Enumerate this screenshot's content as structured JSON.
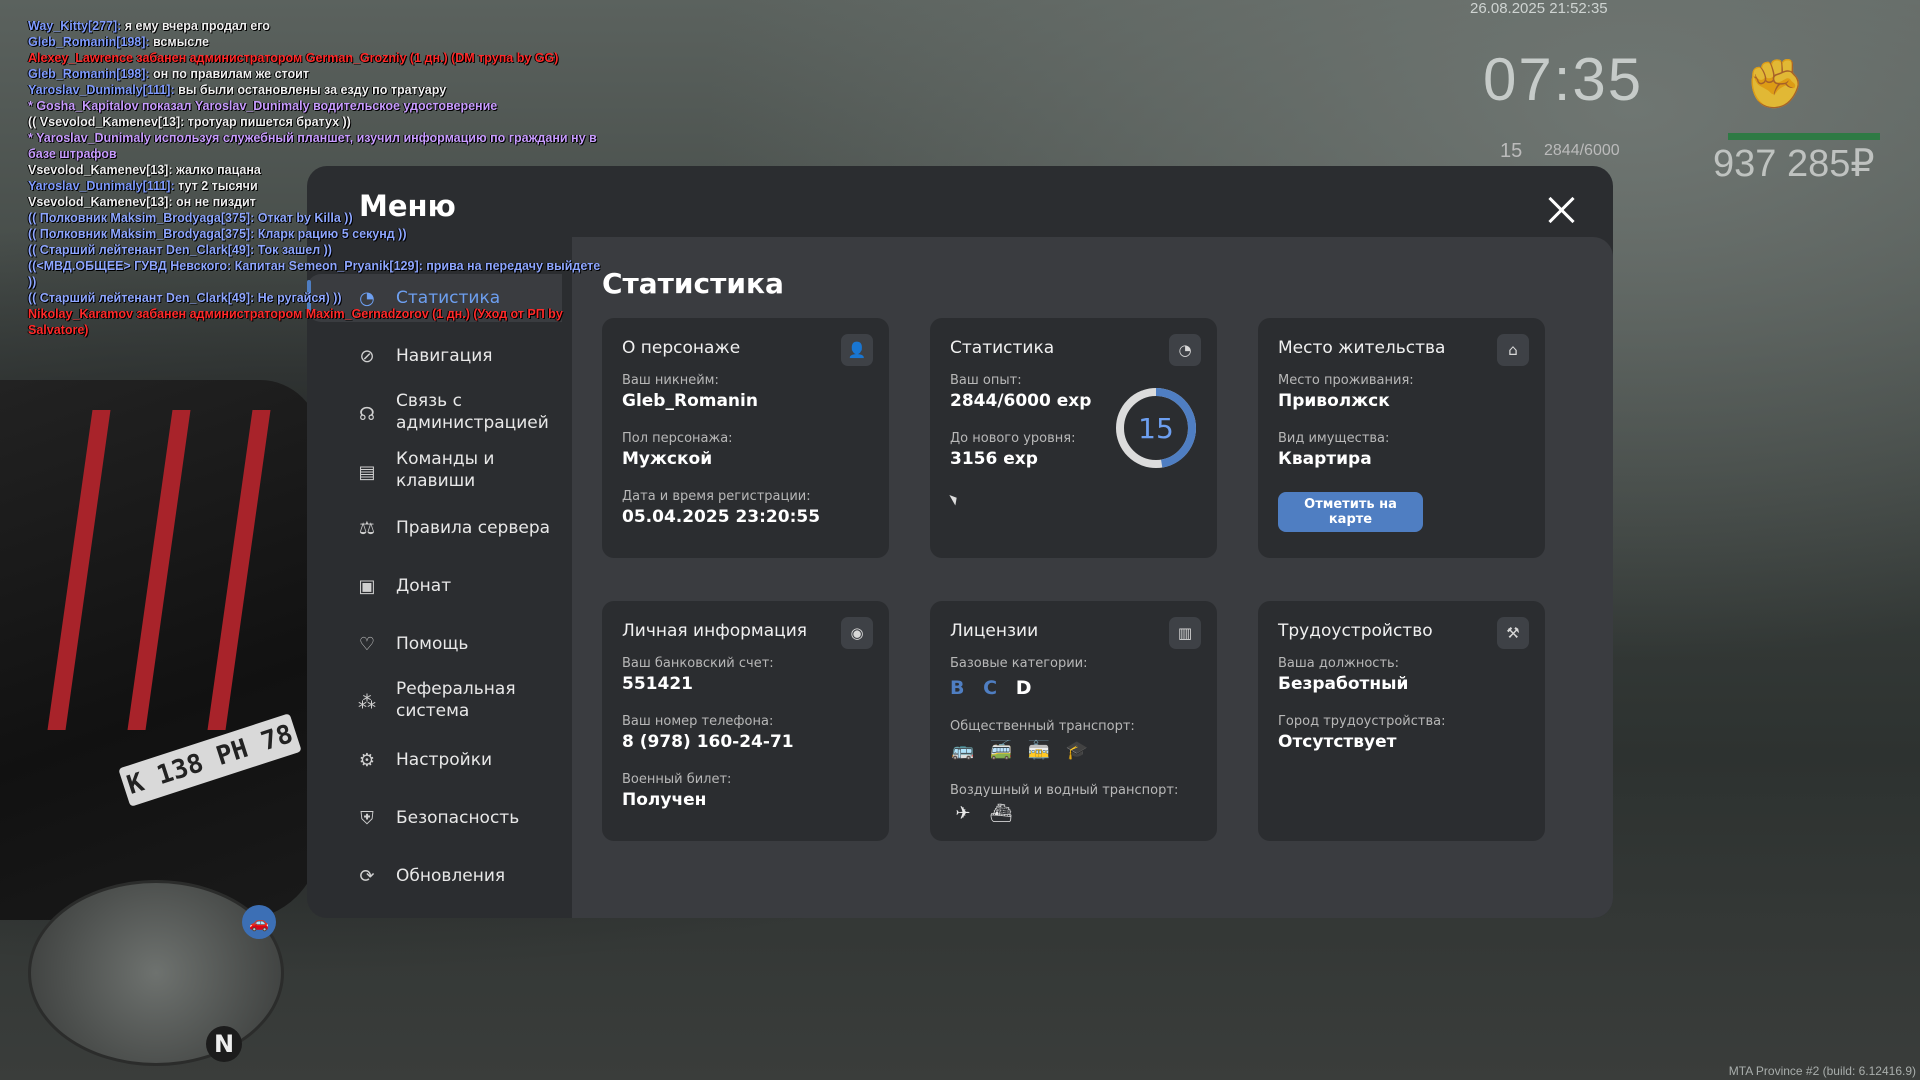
{
  "background": {
    "datetime": "26.08.2025 21:52:35",
    "time": "07:35",
    "level": "15",
    "exp": "2844/6000",
    "money": "937 285₽",
    "plate": "К 138 РН 78",
    "minimap_north": "N",
    "build": "MTA Province #2 (build: 6.12416.9)"
  },
  "chat": [
    {
      "name": "Way_Kitty[277]:",
      "text": " я ему вчера продал его",
      "color": "blue"
    },
    {
      "name": "Gleb_Romanin[198]:",
      "text": " всмысле",
      "color": "blue"
    },
    {
      "name": "",
      "text": "Alexey_Lawrence забанен администратором German_Grozniy (1 дн.) (DM трупа by GG)",
      "color": "red"
    },
    {
      "name": "Gleb_Romanin[198]:",
      "text": " он по правилам же стоит",
      "color": "blue"
    },
    {
      "name": "Yaroslav_Dunimaly[111]:",
      "text": " вы были остановлены за езду по тратуару",
      "color": "blue"
    },
    {
      "name": "",
      "text": "* Gosha_Kapitalov показал Yaroslav_Dunimaly водительское удостоверение",
      "color": "purple"
    },
    {
      "name": "",
      "text": "(( Vsevolod_Kamenev[13]: тротуар пишется братух ))",
      "color": "white"
    },
    {
      "name": "",
      "text": "* Yaroslav_Dunimaly используя служебный планшет, изучил информацию по граждани ну в базе штрафов",
      "color": "purple"
    },
    {
      "name": "",
      "text": "Vsevolod_Kamenev[13]: жалко пацана",
      "color": "white"
    },
    {
      "name": "Yaroslav_Dunimaly[111]:",
      "text": " тут 2 тысячи",
      "color": "blue"
    },
    {
      "name": "",
      "text": "Vsevolod_Kamenev[13]: он не пиздит",
      "color": "white"
    },
    {
      "name": "",
      "text": "(( Полковник Maksim_Brodyaga[375]: Откат by Killa ))",
      "color": "lblue"
    },
    {
      "name": "",
      "text": "(( Полковник Maksim_Brodyaga[375]: Кларк рацию 5 секунд ))",
      "color": "lblue"
    },
    {
      "name": "",
      "text": "(( Старший лейтенант Den_Clark[49]: Ток зашел ))",
      "color": "lblue"
    },
    {
      "name": "",
      "text": "((<МВД.ОБЩЕЕ> ГУВД Невского: Капитан Semeon_Pryanik[129]: прива на передачу выйдете ))",
      "color": "lblue"
    },
    {
      "name": "",
      "text": "(( Старший лейтенант Den_Clark[49]: Не ругайся) ))",
      "color": "lblue"
    },
    {
      "name": "",
      "text": "Nikolay_Karamov забанен администратором Maxim_Gernadzorov (1 дн.) (Уход от РП by Salvatore)",
      "color": "red"
    }
  ],
  "menu": {
    "title": "Меню",
    "nav": [
      {
        "label": "Статистика",
        "icon": "pie-chart-icon",
        "glyph": "◔"
      },
      {
        "label": "Навигация",
        "icon": "compass-icon",
        "glyph": "⊘"
      },
      {
        "label": "Связь с администрацией",
        "icon": "headset-icon",
        "glyph": "☊"
      },
      {
        "label": "Команды и клавиши",
        "icon": "document-icon",
        "glyph": "▤"
      },
      {
        "label": "Правила сервера",
        "icon": "scales-icon",
        "glyph": "⚖"
      },
      {
        "label": "Донат",
        "icon": "wallet-icon",
        "glyph": "▣"
      },
      {
        "label": "Помощь",
        "icon": "handshake-heart-icon",
        "glyph": "♡"
      },
      {
        "label": "Реферальная система",
        "icon": "referral-people-icon",
        "glyph": "⁂"
      },
      {
        "label": "Настройки",
        "icon": "gear-icon",
        "glyph": "⚙"
      },
      {
        "label": "Безопасность",
        "icon": "shield-icon",
        "glyph": "⛨"
      },
      {
        "label": "Обновления",
        "icon": "refresh-icon",
        "glyph": "⟳"
      }
    ]
  },
  "stats": {
    "title": "Статистика",
    "character": {
      "title": "О персонаже",
      "icon": "user-icon",
      "nickname_label": "Ваш никнейм:",
      "nickname": "Gleb_Romanin",
      "gender_label": "Пол персонажа:",
      "gender": "Мужской",
      "reg_label": "Дата и время регистрации:",
      "reg": "05.04.2025 23:20:55"
    },
    "statistics": {
      "title": "Статистика",
      "icon": "pie-chart-icon",
      "exp_label": "Ваш опыт:",
      "exp": "2844/6000 exp",
      "next_label": "До нового уровня:",
      "next": "3156 exp",
      "level": "15",
      "progress": 0.474
    },
    "residence": {
      "title": "Место жительства",
      "icon": "house-icon",
      "place_label": "Место проживания:",
      "place": "Приволжск",
      "type_label": "Вид имущества:",
      "type": "Квартира",
      "button": "Отметить на карте"
    },
    "personal": {
      "title": "Личная информация",
      "icon": "user-circle-icon",
      "bank_label": "Ваш банковский счет:",
      "bank": "551421",
      "phone_label": "Ваш номер телефона:",
      "phone": "8 (978) 160-24-71",
      "military_label": "Военный билет:",
      "military": "Получен"
    },
    "licenses": {
      "title": "Лицензии",
      "icon": "id-card-icon",
      "base_label": "Базовые категории:",
      "categories": [
        {
          "letter": "B",
          "owned": false
        },
        {
          "letter": "C",
          "owned": false
        },
        {
          "letter": "D",
          "owned": true
        }
      ],
      "public_label": "Общественный транспорт:",
      "public": [
        {
          "icon": "bus-icon",
          "owned": false
        },
        {
          "icon": "trolleybus-icon",
          "owned": false
        },
        {
          "icon": "tram-icon",
          "owned": false
        },
        {
          "icon": "taxi-cap-icon",
          "owned": true
        }
      ],
      "air_label": "Воздушный и водный транспорт:",
      "air": [
        {
          "icon": "airplane-icon",
          "owned": true
        },
        {
          "icon": "boat-icon",
          "owned": true
        }
      ]
    },
    "employment": {
      "title": "Трудоустройство",
      "icon": "hammer-icon",
      "position_label": "Ваша должность:",
      "position": "Безработный",
      "city_label": "Город трудоустройства:",
      "city": "Отсутствует"
    }
  }
}
